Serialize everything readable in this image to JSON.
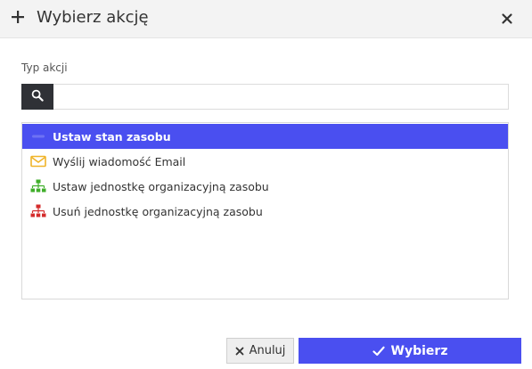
{
  "dialog": {
    "title": "Wybierz akcję",
    "title_icon": "plus-icon",
    "close_icon": "close-icon"
  },
  "search": {
    "label": "Typ akcji",
    "icon": "search-icon",
    "value": "",
    "placeholder": ""
  },
  "actions": {
    "items": [
      {
        "label": "Ustaw stan zasobu",
        "icon": "state-icon",
        "selected": true
      },
      {
        "label": "Wyślij wiadomość Email",
        "icon": "envelope-icon",
        "selected": false
      },
      {
        "label": "Ustaw jednostkę organizacyjną zasobu",
        "icon": "org-chart-green-icon",
        "selected": false
      },
      {
        "label": "Usuń jednostkę organizacyjną zasobu",
        "icon": "org-chart-red-icon",
        "selected": false
      }
    ]
  },
  "footer": {
    "cancel_label": "Anuluj",
    "cancel_icon": "close-icon",
    "confirm_label": "Wybierz",
    "confirm_icon": "check-icon"
  },
  "colors": {
    "accent": "#4a4ff0",
    "header_bg": "#f3f3f3",
    "search_button_bg": "#2f3136",
    "envelope": "#f0b429",
    "org_green": "#3fae2a",
    "org_red": "#d42b2b"
  }
}
